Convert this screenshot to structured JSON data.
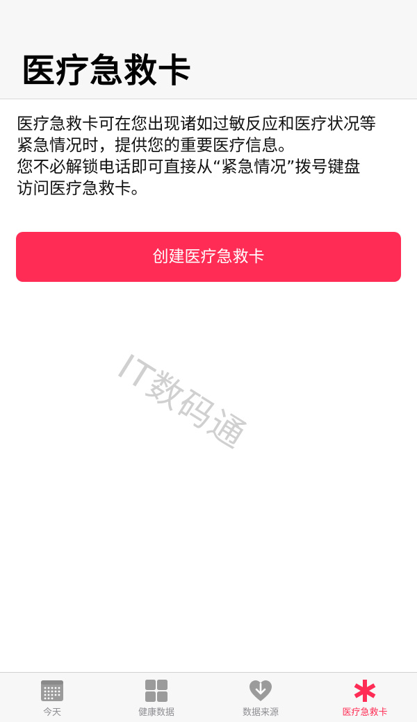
{
  "header": {
    "title": "医疗急救卡"
  },
  "description": {
    "lines": [
      "医疗急救卡可在您出现诸如过敏反应和医疗状况等",
      "紧急情况时，提供您的重要医疗信息。",
      "您不必解锁电话即可直接从“紧急情况”拨号键盘",
      "访问医疗急救卡。"
    ]
  },
  "create_button": {
    "label": "创建医疗急救卡"
  },
  "watermark": {
    "text": "IT数码通"
  },
  "tabbar": {
    "tabs": [
      {
        "label": "今天",
        "icon": "calendar-icon",
        "active": false
      },
      {
        "label": "健康数据",
        "icon": "grid-icon",
        "active": false
      },
      {
        "label": "数据来源",
        "icon": "heart-download-icon",
        "active": false
      },
      {
        "label": "医疗急救卡",
        "icon": "asterisk-icon",
        "active": true
      }
    ]
  },
  "colors": {
    "accent": "#ff2d55",
    "inactive": "#8e8e93",
    "header_bg": "#f7f7f7"
  }
}
